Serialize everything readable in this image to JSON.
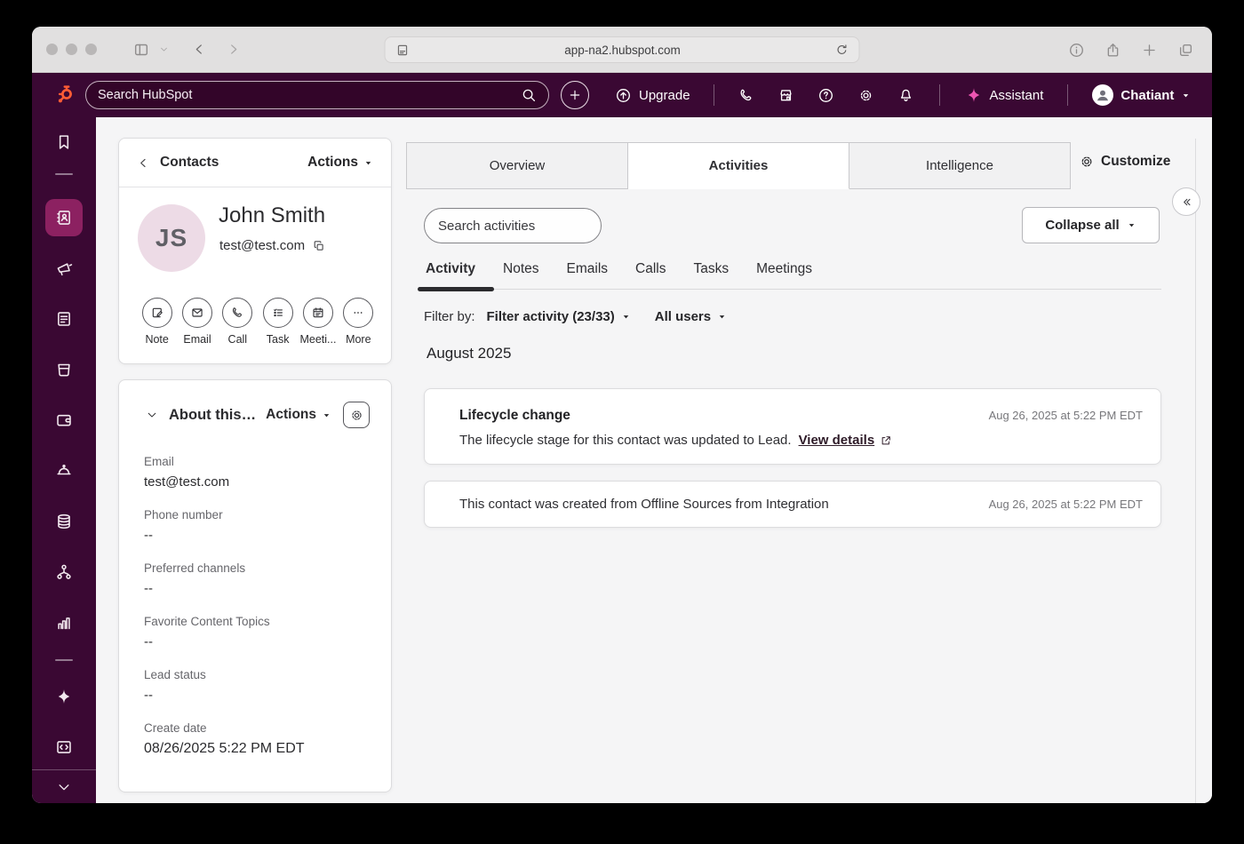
{
  "browser": {
    "url": "app-na2.hubspot.com"
  },
  "nav": {
    "search_placeholder": "Search HubSpot",
    "upgrade_label": "Upgrade",
    "assistant_label": "Assistant",
    "account_name": "Chatiant"
  },
  "contact": {
    "back_label": "Contacts",
    "actions_label": "Actions",
    "initials": "JS",
    "name": "John Smith",
    "email": "test@test.com",
    "quick_actions": [
      {
        "label": "Note"
      },
      {
        "label": "Email"
      },
      {
        "label": "Call"
      },
      {
        "label": "Task"
      },
      {
        "label": "Meeti..."
      },
      {
        "label": "More"
      }
    ]
  },
  "about": {
    "title": "About this…",
    "actions_label": "Actions",
    "fields": [
      {
        "label": "Email",
        "value": "test@test.com"
      },
      {
        "label": "Phone number",
        "value": "--"
      },
      {
        "label": "Preferred channels",
        "value": "--"
      },
      {
        "label": "Favorite Content Topics",
        "value": "--"
      },
      {
        "label": "Lead status",
        "value": "--"
      },
      {
        "label": "Create date",
        "value": "08/26/2025 5:22 PM EDT"
      }
    ]
  },
  "main": {
    "tabs": [
      {
        "label": "Overview"
      },
      {
        "label": "Activities"
      },
      {
        "label": "Intelligence"
      }
    ],
    "customize_label": "Customize",
    "search_placeholder": "Search activities",
    "collapse_all_label": "Collapse all",
    "subtabs": [
      {
        "label": "Activity"
      },
      {
        "label": "Notes"
      },
      {
        "label": "Emails"
      },
      {
        "label": "Calls"
      },
      {
        "label": "Tasks"
      },
      {
        "label": "Meetings"
      }
    ],
    "filter_by_label": "Filter by:",
    "activity_filter": "Filter activity (23/33)",
    "user_filter": "All users",
    "group_heading": "August 2025",
    "cards": [
      {
        "title": "Lifecycle change",
        "timestamp": "Aug 26, 2025 at 5:22 PM EDT",
        "body": "The lifecycle stage for this contact was updated to Lead.",
        "link_label": "View details"
      },
      {
        "body": "This contact was created from Offline Sources from Integration",
        "timestamp": "Aug 26, 2025 at 5:22 PM EDT"
      }
    ]
  },
  "colors": {
    "nav_bg": "#3a0833",
    "active_sidebar_item": "#8c2161",
    "brand_orange": "#ff5c35",
    "assistant_pink": "#ee55b2",
    "link_dark": "#2e1b28",
    "avatar_bg": "#eddbe6"
  }
}
